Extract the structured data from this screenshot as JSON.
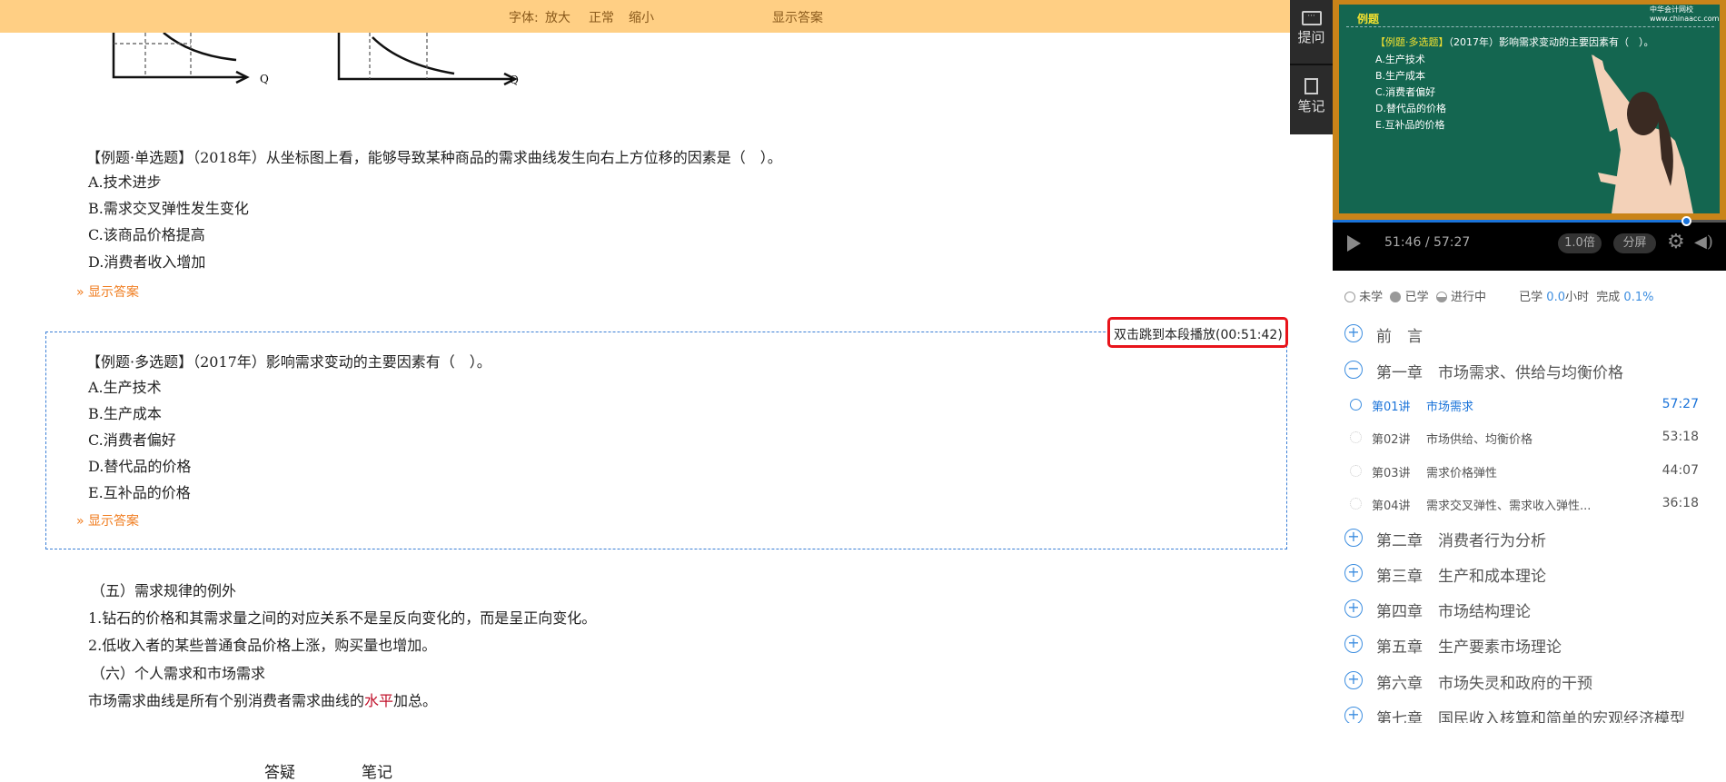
{
  "toolbar": {
    "font_label": "字体:",
    "enlarge": "放大",
    "normal": "正常",
    "shrink": "缩小",
    "show_answer": "显示答案"
  },
  "graphs": {
    "axis_label": "Q"
  },
  "q1": {
    "title": "【例题·单选题】（2018年）从坐标图上看，能够导致某种商品的需求曲线发生向右上方位移的因素是（　）。",
    "options": [
      "A.技术进步",
      "B.需求交叉弹性发生变化",
      "C.该商品价格提高",
      "D.消费者收入增加"
    ],
    "show_answer": "» 显示答案"
  },
  "q2": {
    "jump_tip": "双击跳到本段播放(00:51:42)",
    "title": "【例题·多选题】（2017年）影响需求变动的主要因素有（　）。",
    "options": [
      "A.生产技术",
      "B.生产成本",
      "C.消费者偏好",
      "D.替代品的价格",
      "E.互补品的价格"
    ],
    "show_answer": "» 显示答案"
  },
  "section": {
    "lines": [
      "（五）需求规律的例外",
      "1.钻石的价格和其需求量之间的对应关系不是呈反向变化的，而是呈正向变化。",
      "2.低收入者的某些普通食品价格上涨，购买量也增加。",
      "（六）个人需求和市场需求"
    ],
    "last_pre": "市场需求曲线是所有个别消费者需求曲线的",
    "last_red": "水平",
    "last_post": "加总。"
  },
  "bottom_tabs": [
    "答疑",
    "笔记"
  ],
  "side": {
    "ask": "提问",
    "notes": "笔记"
  },
  "video": {
    "board_heading": "例题",
    "logo": "中华会计网校",
    "logo_url": "www.chinaacc.com",
    "board_title_tag": "【例题·多选题】",
    "board_title": "（2017年）影响需求变动的主要因素有（　）。",
    "board_options": [
      "A.生产技术",
      "B.生产成本",
      "C.消费者偏好",
      "D.替代品的价格",
      "E.互补品的价格"
    ],
    "current": "51:46",
    "sep": "/",
    "total": "57:27",
    "progress": 0.9,
    "speed": "1.0倍",
    "split": "分屏"
  },
  "legend": {
    "not_learned": "未学",
    "learned": "已学",
    "in_progress": "进行中",
    "studied_label": "已学",
    "studied_value": "0.0",
    "hours_unit": "小时",
    "complete_label": "完成",
    "complete_value": "0.1%"
  },
  "tree": {
    "preface": "前　言",
    "chapter1": "第一章　市场需求、供给与均衡价格",
    "lectures": [
      {
        "num": "第01讲",
        "name": "市场需求",
        "time": "57:27"
      },
      {
        "num": "第02讲",
        "name": "市场供给、均衡价格",
        "time": "53:18"
      },
      {
        "num": "第03讲",
        "name": "需求价格弹性",
        "time": "44:07"
      },
      {
        "num": "第04讲",
        "name": "需求交叉弹性、需求收入弹性...",
        "time": "36:18"
      }
    ],
    "chapters": [
      "第二章　消费者行为分析",
      "第三章　生产和成本理论",
      "第四章　市场结构理论",
      "第五章　生产要素市场理论",
      "第六章　市场失灵和政府的干预",
      "第七章　国民收入核算和简单的宏观经济模型"
    ]
  },
  "colors": {
    "accent": "#3d8ee0",
    "toolbar": "#ffcf84",
    "link": "#f07c1e",
    "highlight_red": "#c0102a"
  }
}
